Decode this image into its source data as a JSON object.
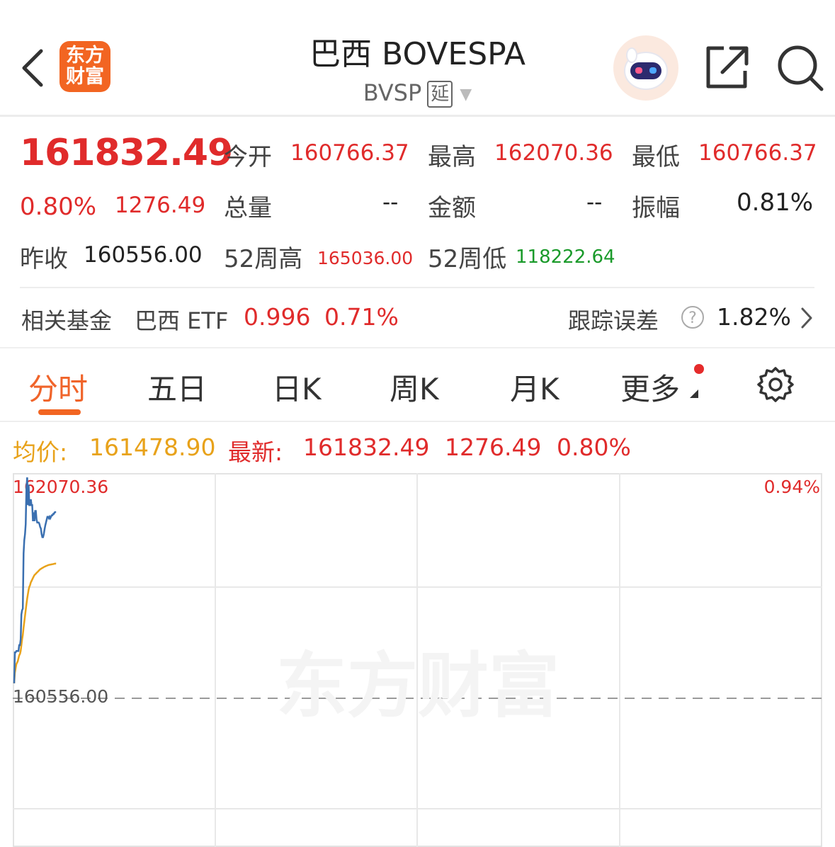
{
  "header": {
    "logo_line1": "东方",
    "logo_line2": "财富",
    "title": "巴西 BOVESPA",
    "code": "BVSP",
    "delay_tag": "延"
  },
  "quote": {
    "price": "161832.49",
    "change_pct": "0.80%",
    "change_amt": "1276.49",
    "open_label": "今开",
    "open": "160766.37",
    "high_label": "最高",
    "high": "162070.36",
    "low_label": "最低",
    "low": "160766.37",
    "volume_label": "总量",
    "volume": "--",
    "amount_label": "金额",
    "amount": "--",
    "amplitude_label": "振幅",
    "amplitude": "0.81%",
    "prev_close_label": "昨收",
    "prev_close": "160556.00",
    "wk52_high_label": "52周高",
    "wk52_high": "165036.00",
    "wk52_low_label": "52周低",
    "wk52_low": "118222.64"
  },
  "fund": {
    "label": "相关基金",
    "name": "巴西 ETF",
    "price": "0.996",
    "change": "0.71%",
    "tracking_label": "跟踪误差",
    "tracking_value": "1.82%"
  },
  "tabs": [
    {
      "label": "分时",
      "active": true
    },
    {
      "label": "五日"
    },
    {
      "label": "日K"
    },
    {
      "label": "周K"
    },
    {
      "label": "月K"
    },
    {
      "label": "更多"
    }
  ],
  "chart_info": {
    "avg_label": "均价:",
    "avg_value": "161478.90",
    "latest_label": "最新:",
    "latest_value": "161832.49",
    "latest_change": "1276.49",
    "latest_pct": "0.80%"
  },
  "chart_data": {
    "type": "line",
    "top_label": "162070.36",
    "top_pct": "0.94%",
    "baseline_label": "160556.00",
    "watermark": "东方财富",
    "ylim": [
      160556.0,
      162070.36
    ],
    "series": [
      {
        "name": "最新",
        "color": "#3a6fb0",
        "x": [
          0,
          1,
          2,
          3,
          4,
          5,
          6,
          7,
          8,
          9,
          10,
          11,
          12,
          13,
          14,
          15,
          16,
          17,
          18,
          19,
          20,
          21,
          22,
          23,
          24,
          25,
          26,
          27,
          28,
          29,
          30,
          31,
          32,
          33,
          34,
          35,
          36,
          37,
          38,
          39,
          40,
          41,
          42,
          43,
          44,
          45,
          46,
          47,
          48,
          49,
          50,
          51,
          52,
          53,
          54,
          55,
          56,
          57,
          58
        ],
        "values": [
          160659,
          160870,
          160870,
          160880,
          160880,
          160880,
          160880,
          160920,
          160920,
          160960,
          161130,
          161160,
          161170,
          161550,
          161640,
          161680,
          161750,
          161990,
          162070,
          161880,
          162020,
          161880,
          161880,
          161920,
          161880,
          161880,
          161770,
          161830,
          161770,
          161840,
          161840,
          161780,
          161760,
          161760,
          161760,
          161750,
          161730,
          161720,
          161680,
          161660,
          161660,
          161680,
          161710,
          161740,
          161760,
          161780,
          161800,
          161800,
          161790,
          161800,
          161790,
          161800,
          161810,
          161810,
          161820,
          161820,
          161830,
          161832,
          161832
        ]
      },
      {
        "name": "均价",
        "color": "#e8a21a",
        "x": [
          0,
          1,
          2,
          3,
          4,
          5,
          6,
          7,
          8,
          9,
          10,
          11,
          12,
          13,
          14,
          15,
          16,
          17,
          18,
          19,
          20,
          21,
          22,
          23,
          24,
          25,
          26,
          27,
          28,
          29,
          30,
          31,
          32,
          33,
          34,
          35,
          36,
          37,
          38,
          39,
          40,
          41,
          42,
          43,
          44,
          45,
          46,
          47,
          48,
          49,
          50,
          51,
          52,
          53,
          54,
          55,
          56,
          57,
          58
        ],
        "values": [
          160659,
          160730,
          160760,
          160790,
          160800,
          160810,
          160830,
          160850,
          160860,
          160880,
          160920,
          160960,
          160990,
          161040,
          161080,
          161120,
          161160,
          161200,
          161240,
          161270,
          161300,
          161320,
          161330,
          161350,
          161360,
          161370,
          161380,
          161390,
          161400,
          161405,
          161410,
          161415,
          161420,
          161425,
          161430,
          161435,
          161440,
          161443,
          161446,
          161449,
          161452,
          161455,
          161458,
          161460,
          161462,
          161464,
          161466,
          161468,
          161470,
          161471,
          161472,
          161473,
          161474,
          161475,
          161476,
          161477,
          161478,
          161479,
          161478.9
        ]
      }
    ]
  }
}
